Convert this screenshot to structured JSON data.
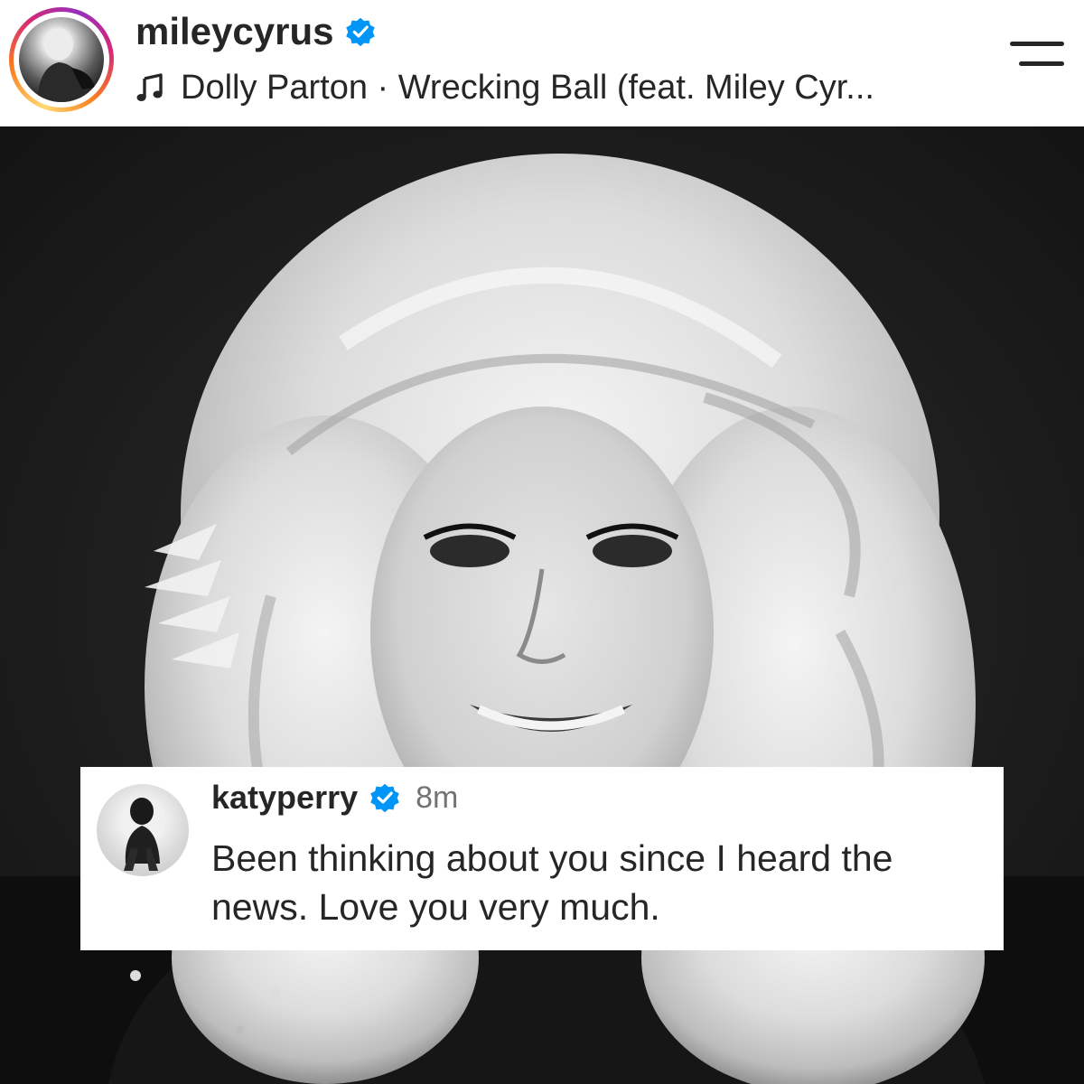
{
  "header": {
    "username": "mileycyrus",
    "audio": "Dolly Parton · Wrecking Ball (feat. Miley Cyr...",
    "avatar_icon": "profile-avatar",
    "music_icon": "music-note-icon",
    "verified_icon": "verified-badge-icon",
    "menu_icon": "menu-icon"
  },
  "comment": {
    "username": "katyperry",
    "time": "8m",
    "text": "Been thinking about you since I heard the news. Love you very much."
  },
  "colors": {
    "verified_blue": "#0095f6",
    "text_primary": "#262626",
    "text_secondary": "#737373"
  }
}
